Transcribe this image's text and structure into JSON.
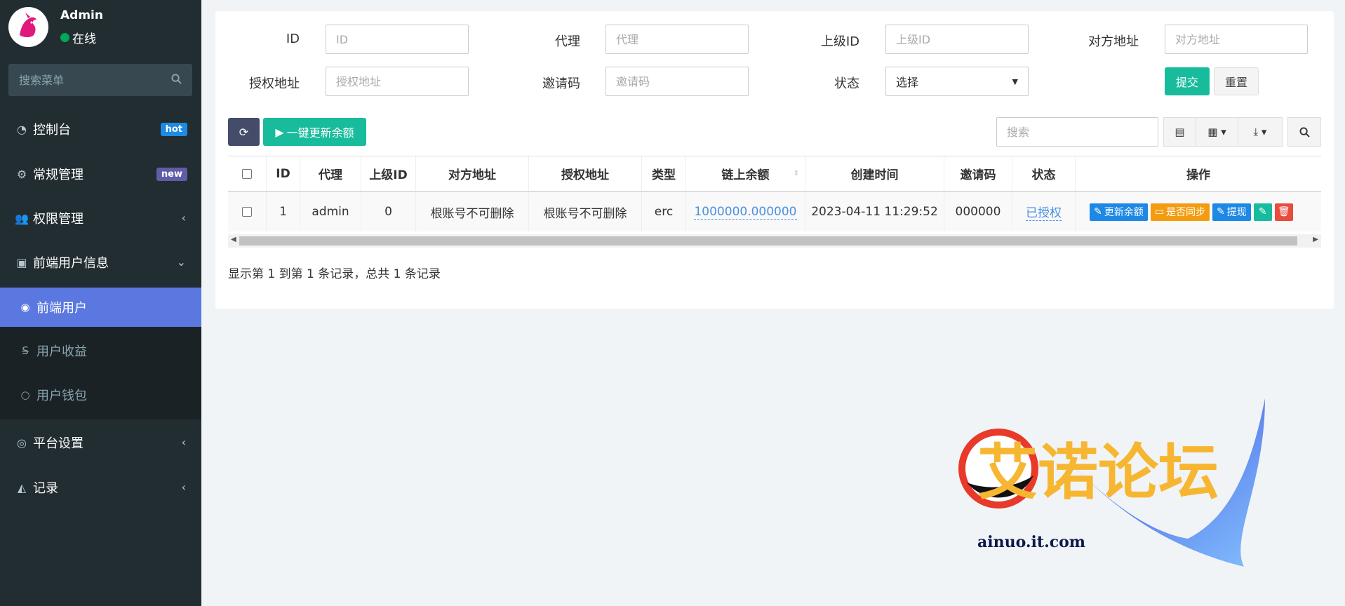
{
  "sidebar": {
    "user": {
      "name": "Admin",
      "status": "在线"
    },
    "search_placeholder": "搜索菜单",
    "items": [
      {
        "label": "控制台",
        "icon": "dashboard-icon",
        "badge": "hot"
      },
      {
        "label": "常规管理",
        "icon": "cogs-icon",
        "badge": "new"
      },
      {
        "label": "权限管理",
        "icon": "users-icon"
      },
      {
        "label": "前端用户信息",
        "icon": "user-card-icon"
      },
      {
        "label": "平台设置",
        "icon": "target-icon"
      },
      {
        "label": "记录",
        "icon": "area-chart-icon"
      }
    ],
    "submenu": [
      {
        "label": "前端用户",
        "icon": "user-circle-icon"
      },
      {
        "label": "用户收益",
        "icon": "strike-icon"
      },
      {
        "label": "用户钱包",
        "icon": "circle-icon"
      }
    ]
  },
  "filters": {
    "id_label": "ID",
    "id_placeholder": "ID",
    "agent_label": "代理",
    "agent_placeholder": "代理",
    "parent_label": "上级ID",
    "parent_placeholder": "上级ID",
    "peer_label": "对方地址",
    "peer_placeholder": "对方地址",
    "auth_label": "授权地址",
    "auth_placeholder": "授权地址",
    "invite_label": "邀请码",
    "invite_placeholder": "邀请码",
    "status_label": "状态",
    "status_value": "选择",
    "submit": "提交",
    "reset": "重置"
  },
  "toolbar": {
    "update_all": "一键更新余额",
    "search_placeholder": "搜索"
  },
  "table": {
    "headers": [
      "ID",
      "代理",
      "上级ID",
      "对方地址",
      "授权地址",
      "类型",
      "链上余额",
      "创建时间",
      "邀请码",
      "状态",
      "操作"
    ],
    "rows": [
      {
        "id": "1",
        "agent": "admin",
        "parent": "0",
        "peer": "根账号不可删除",
        "auth": "根账号不可删除",
        "type": "erc",
        "balance": "1000000.000000",
        "created": "2023-04-11 11:29:52",
        "invite": "000000",
        "status": "已授权",
        "ops": {
          "update": "更新余额",
          "sync": "是否同步",
          "withdraw": "提现"
        }
      }
    ]
  },
  "pager": "显示第 1 到第 1 条记录，总共 1 条记录",
  "watermark": {
    "title": "艾诺论坛",
    "url": "ainuo.it.com"
  }
}
